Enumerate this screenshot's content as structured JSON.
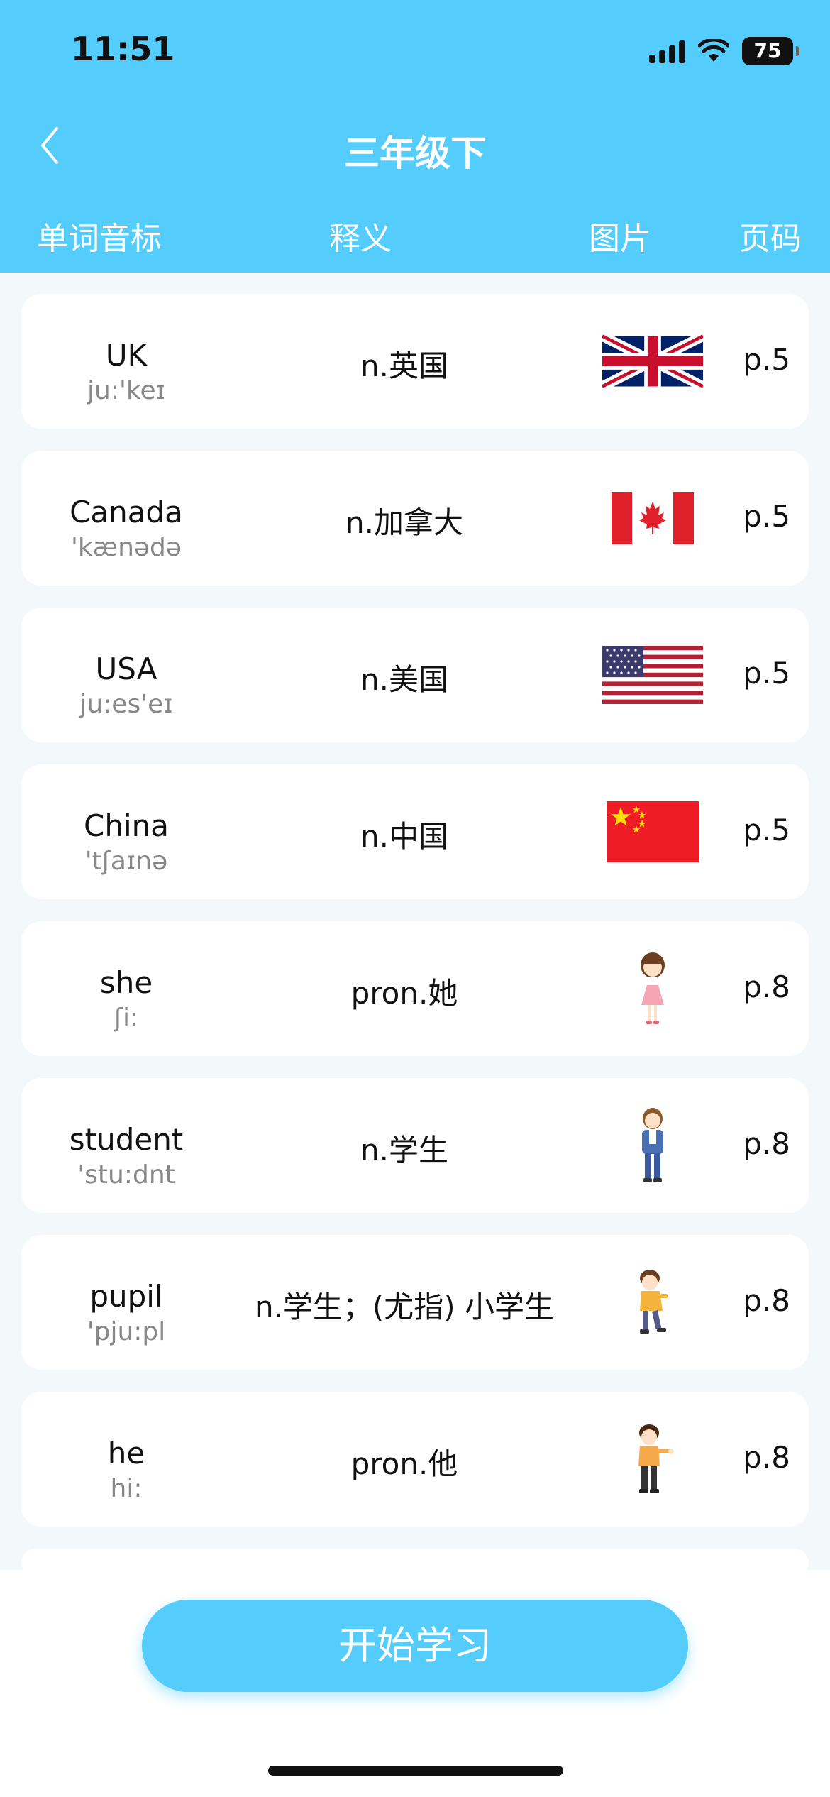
{
  "status_bar": {
    "time": "11:51",
    "battery": "75"
  },
  "header": {
    "title": "三年级下"
  },
  "columns": {
    "word": "单词音标",
    "meaning": "释义",
    "picture": "图片",
    "page": "页码"
  },
  "words": [
    {
      "word": "UK",
      "phonetic": "ju:'keɪ",
      "meaning": "n.英国",
      "page": "p.5",
      "picture": "uk-flag"
    },
    {
      "word": "Canada",
      "phonetic": "'kænədə",
      "meaning": "n.加拿大",
      "page": "p.5",
      "picture": "canada-flag"
    },
    {
      "word": "USA",
      "phonetic": "ju:es'eɪ",
      "meaning": "n.美国",
      "page": "p.5",
      "picture": "usa-flag"
    },
    {
      "word": "China",
      "phonetic": "'tʃaɪnə",
      "meaning": "n.中国",
      "page": "p.5",
      "picture": "china-flag"
    },
    {
      "word": "she",
      "phonetic": "ʃi:",
      "meaning": "pron.她",
      "page": "p.8",
      "picture": "girl-cartoon"
    },
    {
      "word": "student",
      "phonetic": "'stu:dnt",
      "meaning": "n.学生",
      "page": "p.8",
      "picture": "student-cartoon"
    },
    {
      "word": "pupil",
      "phonetic": "'pju:pl",
      "meaning": "n.学生；(尤指) 小学生",
      "page": "p.8",
      "picture": "boy-cartoon"
    },
    {
      "word": "he",
      "phonetic": "hi:",
      "meaning": "pron.他",
      "page": "p.8",
      "picture": "boy-waving-cartoon"
    }
  ],
  "footer": {
    "start_button": "开始学习"
  },
  "colors": {
    "accent": "#55cdfc",
    "background": "#f3f8fa"
  }
}
